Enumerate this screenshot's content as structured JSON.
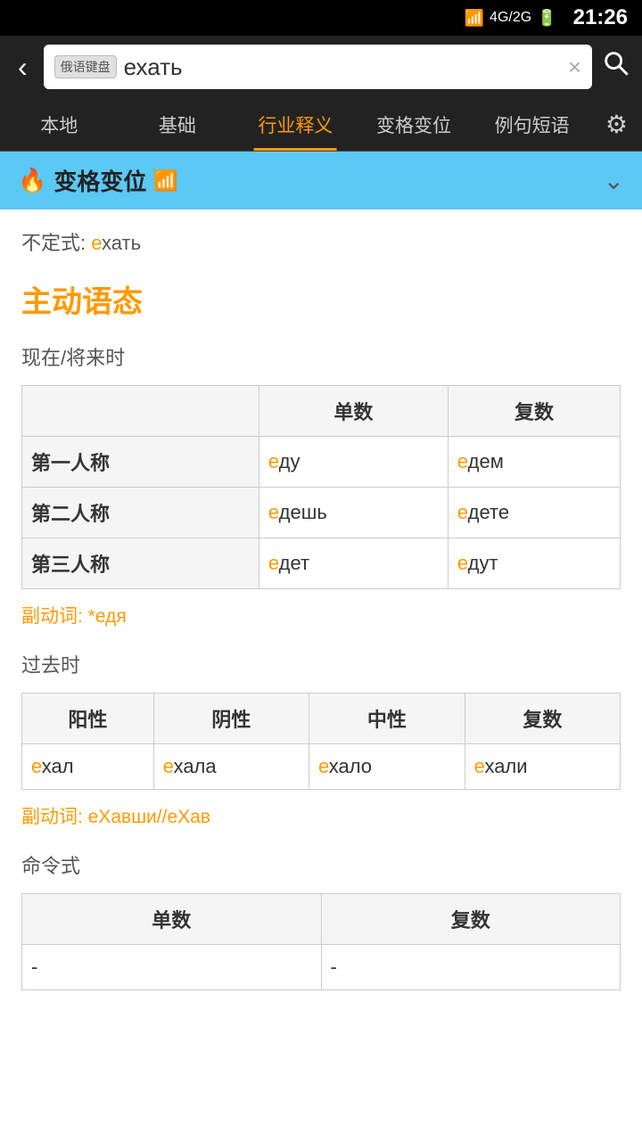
{
  "statusBar": {
    "time": "21:26",
    "icons": [
      "wifi",
      "4g-2g",
      "battery"
    ]
  },
  "searchBar": {
    "backLabel": "‹",
    "keyboardBadge": "俄语键盘",
    "searchValue": "ехать",
    "clearIcon": "×",
    "searchIcon": "🔍"
  },
  "navTabs": [
    {
      "id": "local",
      "label": "本地",
      "active": false
    },
    {
      "id": "basic",
      "label": "基础",
      "active": false
    },
    {
      "id": "industry",
      "label": "行业释义",
      "active": true
    },
    {
      "id": "conjugation",
      "label": "变格变位",
      "active": false
    },
    {
      "id": "examples",
      "label": "例句短语",
      "active": false
    }
  ],
  "settings": {
    "icon": "⚙"
  },
  "sectionHeader": {
    "fireIcon": "🔥",
    "title": "变格变位",
    "wifiIcon": "📶"
  },
  "infinitive": {
    "label": "不定式:",
    "prefix": "е",
    "suffix": "хать"
  },
  "activeVoice": {
    "title": "主动语态"
  },
  "presentFuture": {
    "label": "现在/将来时",
    "headers": [
      "",
      "单数",
      "复数"
    ],
    "rows": [
      {
        "person": "第一人称",
        "singular": {
          "prefix": "е",
          "suffix": "ду"
        },
        "plural": {
          "prefix": "е",
          "suffix": "дем"
        }
      },
      {
        "person": "第二人称",
        "singular": {
          "prefix": "е",
          "suffix": "дешь"
        },
        "plural": {
          "prefix": "е",
          "suffix": "дете"
        }
      },
      {
        "person": "第三人称",
        "singular": {
          "prefix": "е",
          "suffix": "дет"
        },
        "plural": {
          "prefix": "е",
          "suffix": "дут"
        }
      }
    ],
    "adverb": "副动词: *еДя"
  },
  "pastTense": {
    "label": "过去时",
    "headers": [
      "阳性",
      "阴性",
      "中性",
      "复数"
    ],
    "rows": [
      {
        "masc": {
          "prefix": "е",
          "suffix": "хал"
        },
        "fem": {
          "prefix": "е",
          "suffix": "хала"
        },
        "neut": {
          "prefix": "е",
          "suffix": "хало"
        },
        "plur": {
          "prefix": "е",
          "suffix": "хали"
        }
      }
    ],
    "adverb": "副动词: еХавши//еХав"
  },
  "imperative": {
    "label": "命令式",
    "headers": [
      "单数",
      "复数"
    ],
    "rows": [
      {
        "singular": "-",
        "plural": "-"
      }
    ]
  }
}
